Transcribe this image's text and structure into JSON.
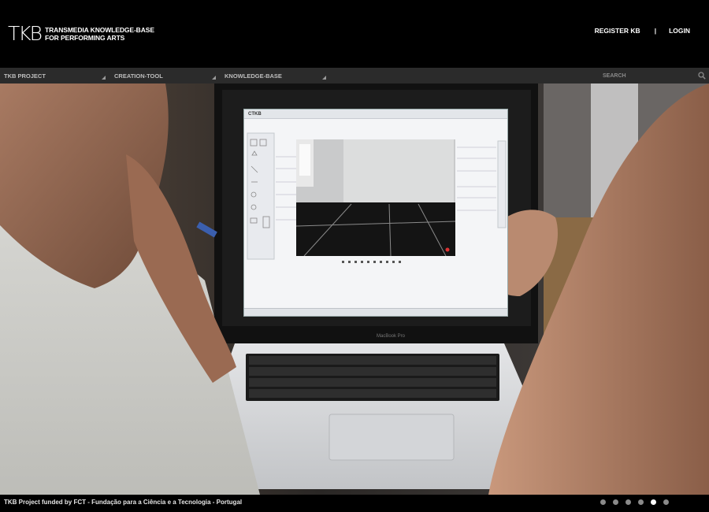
{
  "header": {
    "logo_mark": "TKB",
    "logo_line1": "TRANSMEDIA KNOWLEDGE-BASE",
    "logo_line2": "FOR PERFORMING ARTS",
    "register_label": "REGISTER KB",
    "separator": "|",
    "login_label": "LOGIN"
  },
  "nav": {
    "items": [
      {
        "label": "TKB PROJECT"
      },
      {
        "label": "CREATION-TOOL"
      },
      {
        "label": "KNOWLEDGE-BASE"
      }
    ],
    "search_placeholder": "SEARCH"
  },
  "hero": {
    "screen_app_title": "CTKB",
    "laptop_brand": "MacBook Pro"
  },
  "footer": {
    "text": "TKB Project funded by FCT - Fundação para a Ciência e a Tecnologia - Portugal",
    "slide_count": 6,
    "active_slide": 5
  },
  "colors": {
    "background": "#000000",
    "navbar": "#2b2b2b",
    "nav_text": "#bdbdbd",
    "dot_inactive": "#8a8a8a",
    "dot_active": "#ffffff"
  }
}
